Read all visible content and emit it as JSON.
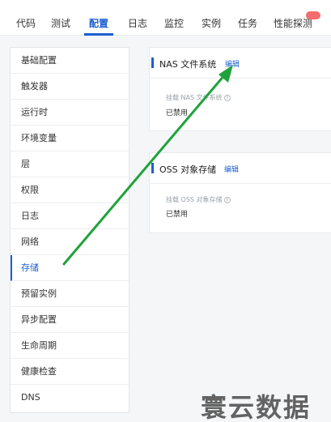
{
  "tabs": [
    {
      "label": "代码"
    },
    {
      "label": "测试"
    },
    {
      "label": "配置"
    },
    {
      "label": "日志"
    },
    {
      "label": "监控"
    },
    {
      "label": "实例"
    },
    {
      "label": "任务"
    },
    {
      "label": "性能探测"
    }
  ],
  "active_tab": "配置",
  "sidebar": {
    "items": [
      {
        "label": "基础配置"
      },
      {
        "label": "触发器"
      },
      {
        "label": "运行时"
      },
      {
        "label": "环境变量"
      },
      {
        "label": "层"
      },
      {
        "label": "权限"
      },
      {
        "label": "日志"
      },
      {
        "label": "网络"
      },
      {
        "label": "存储"
      },
      {
        "label": "预留实例"
      },
      {
        "label": "异步配置"
      },
      {
        "label": "生命周期"
      },
      {
        "label": "健康检查"
      },
      {
        "label": "DNS"
      }
    ],
    "active_item": "存储"
  },
  "cards": {
    "nas": {
      "title": "NAS 文件系统",
      "edit_label": "编辑",
      "field_label": "挂载 NAS 文件系统",
      "field_value": "已禁用"
    },
    "oss": {
      "title": "OSS 对象存储",
      "edit_label": "编辑",
      "field_label": "挂载 OSS 对象存储",
      "field_value": "已禁用"
    }
  },
  "watermark": "寰云数据",
  "colors": {
    "accent": "#1b5fd2",
    "arrow": "#1fa23a",
    "badge": "#f56c6c"
  },
  "icons": {
    "help": "help-circle-icon",
    "arrow": "annotation-arrow-icon"
  }
}
